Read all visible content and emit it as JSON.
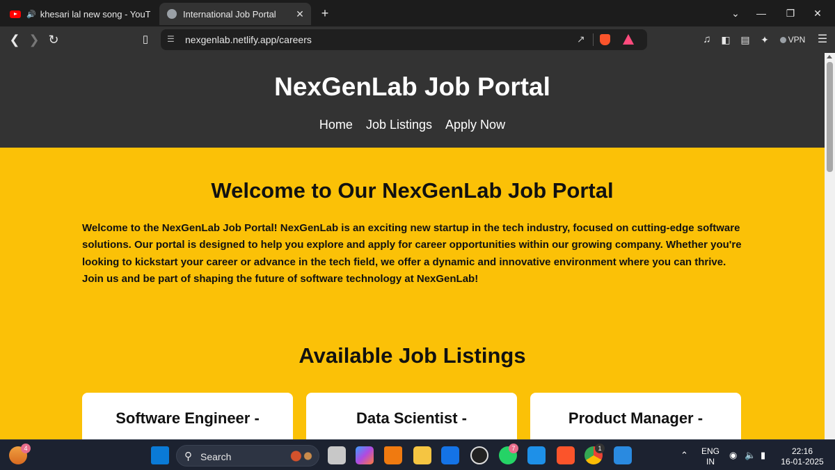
{
  "browser": {
    "tabs": [
      {
        "title": "khesari lal new song - YouTube",
        "favicon": "youtube-icon",
        "audio": true,
        "active": false
      },
      {
        "title": "International Job Portal",
        "favicon": "globe-icon",
        "active": true
      }
    ],
    "url": "nexgenlab.netlify.app/careers",
    "vpn_label": "VPN"
  },
  "page": {
    "site_title": "NexGenLab Job Portal",
    "nav": [
      "Home",
      "Job Listings",
      "Apply Now"
    ],
    "welcome_heading": "Welcome to Our NexGenLab Job Portal",
    "welcome_text": "Welcome to the NexGenLab Job Portal! NexGenLab is an exciting new startup in the tech industry, focused on cutting-edge software solutions. Our portal is designed to help you explore and apply for career opportunities within our growing company. Whether you're looking to kickstart your career or advance in the tech field, we offer a dynamic and innovative environment where you can thrive. Join us and be part of shaping the future of software technology at NexGenLab!",
    "jobs_heading": "Available Job Listings",
    "jobs": [
      {
        "title": "Software Engineer -"
      },
      {
        "title": "Data Scientist -"
      },
      {
        "title": "Product Manager -"
      }
    ],
    "colors": {
      "header_bg": "#333333",
      "page_bg": "#fbc107",
      "card_bg": "#ffffff"
    }
  },
  "taskbar": {
    "search_label": "Search",
    "widget_badge": "4",
    "whatsapp_badge": "7",
    "chrome_badge": "1",
    "language": "ENG",
    "region": "IN",
    "time": "22:16",
    "date": "16-01-2025"
  }
}
